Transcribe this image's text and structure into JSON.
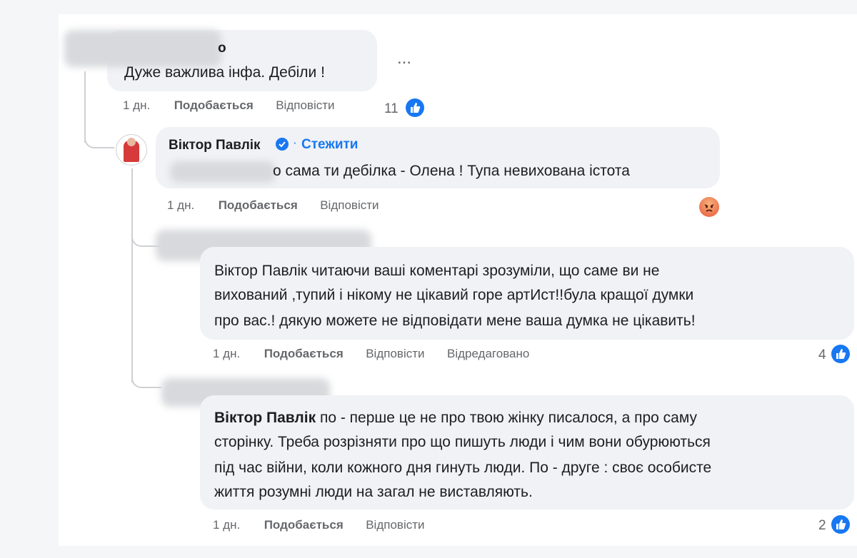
{
  "comments": [
    {
      "author_visible": "о",
      "text": "Дуже важлива інфа. Дебіли !",
      "time": "1 дн.",
      "like_label": "Подобається",
      "reply_label": "Відповісти",
      "reactions_count": "11",
      "more_menu": "..."
    },
    {
      "author": "Віктор Павлік",
      "verified": true,
      "follow_label": "Стежити",
      "text_visible": "о сама ти дебілка - Олена ! Тупа невихована істота",
      "time": "1 дн.",
      "like_label": "Подобається",
      "reply_label": "Відповісти",
      "reaction": "angry"
    },
    {
      "lines": [
        "Віктор Павлік читаючи ваші коментарі зрозуміли, що саме ви не",
        "вихований ,тупий і нікому не цікавий горе артИст!!була кращої думки",
        "про вас.! дякую можете не відповідати мене ваша думка не цікавить!"
      ],
      "time": "1 дн.",
      "like_label": "Подобається",
      "reply_label": "Відповісти",
      "edited_label": "Відредаговано",
      "reactions_count": "4"
    },
    {
      "mention": "Віктор Павлік",
      "lines": [
        " по - перше це не про твою жінку писалося, а про саму",
        "сторінку. Треба розрізняти про що пишуть люди і чим вони обурюються",
        "під час війни, коли кожного дня гинуть люди. По - друге : своє особисте",
        "життя розумні люди на загал не виставляють."
      ],
      "time": "1 дн.",
      "like_label": "Подобається",
      "reply_label": "Відповісти",
      "reactions_count": "2"
    }
  ],
  "colors": {
    "link_blue": "#1877f2",
    "bubble_bg": "#f0f2f5",
    "meta_gray": "#65676b"
  }
}
